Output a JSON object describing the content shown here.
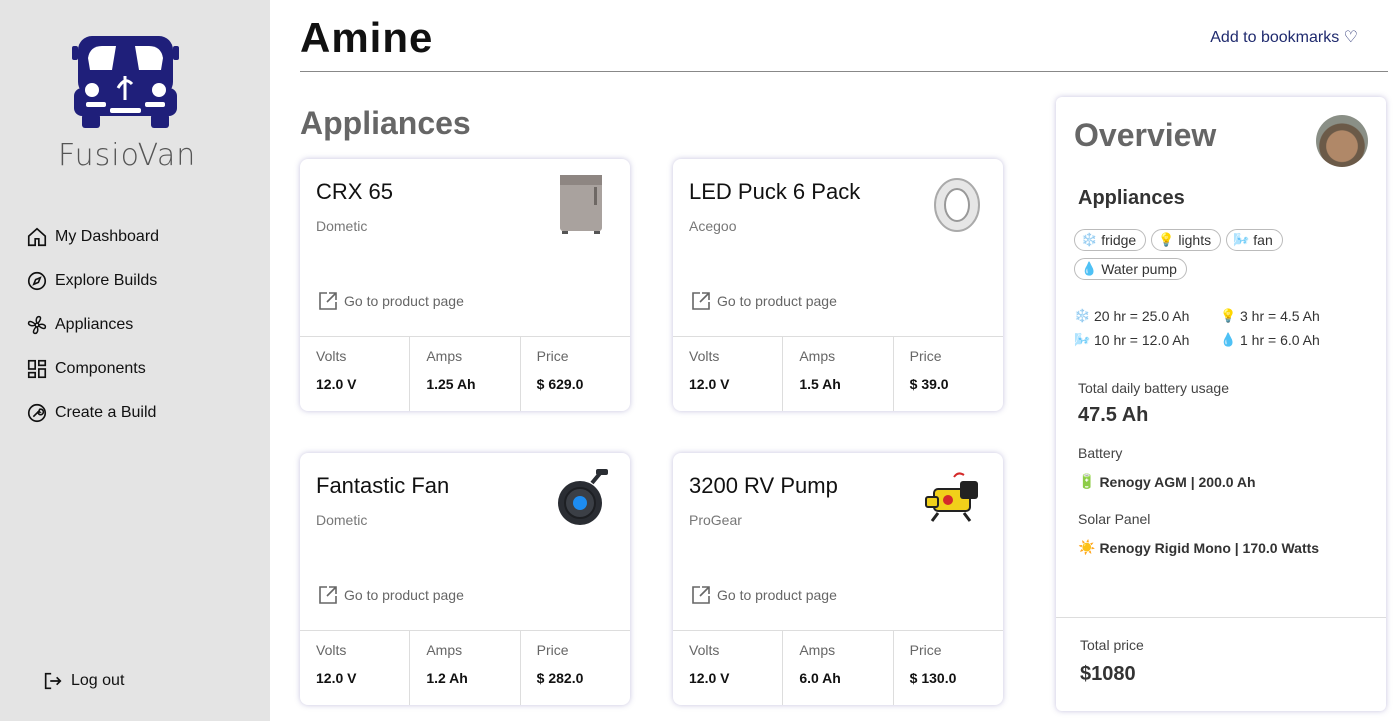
{
  "brand": {
    "name": "FusioVan"
  },
  "nav": [
    {
      "label": "My Dashboard",
      "icon": "home-icon"
    },
    {
      "label": "Explore Builds",
      "icon": "compass-icon"
    },
    {
      "label": "Appliances",
      "icon": "fan-icon"
    },
    {
      "label": "Components",
      "icon": "grid-icon"
    },
    {
      "label": "Create a Build",
      "icon": "wrench-icon"
    }
  ],
  "logout": {
    "label": "Log out"
  },
  "header": {
    "title": "Amine",
    "bookmark": "Add to bookmarks ♡"
  },
  "appliances_section": {
    "title": "Appliances"
  },
  "cards": [
    {
      "name": "CRX 65",
      "brand": "Dometic",
      "link": "Go to product page",
      "volts_label": "Volts",
      "volts": "12.0 V",
      "amps_label": "Amps",
      "amps": "1.25 Ah",
      "price_label": "Price",
      "price": "$ 629.0",
      "image": "fridge-image"
    },
    {
      "name": "LED Puck 6 Pack",
      "brand": "Acegoo",
      "link": "Go to product page",
      "volts_label": "Volts",
      "volts": "12.0 V",
      "amps_label": "Amps",
      "amps": "1.5 Ah",
      "price_label": "Price",
      "price": "$ 39.0",
      "image": "led-puck-image"
    },
    {
      "name": "Fantastic Fan",
      "brand": "Dometic",
      "link": "Go to product page",
      "volts_label": "Volts",
      "volts": "12.0 V",
      "amps_label": "Amps",
      "amps": "1.2 Ah",
      "price_label": "Price",
      "price": "$ 282.0",
      "image": "fan-image"
    },
    {
      "name": "3200 RV Pump",
      "brand": "ProGear",
      "link": "Go to product page",
      "volts_label": "Volts",
      "volts": "12.0 V",
      "amps_label": "Amps",
      "amps": "6.0 Ah",
      "price_label": "Price",
      "price": "$ 130.0",
      "image": "pump-image"
    }
  ],
  "overview": {
    "title": "Overview",
    "subtitle": "Appliances",
    "chips": [
      {
        "emoji": "❄️",
        "label": "fridge"
      },
      {
        "emoji": "💡",
        "label": "lights"
      },
      {
        "emoji": "🌬️",
        "label": "fan"
      },
      {
        "emoji": "💧",
        "label": "Water pump"
      }
    ],
    "usage": [
      {
        "emoji": "❄️",
        "text": "20 hr = 25.0 Ah"
      },
      {
        "emoji": "💡",
        "text": "3 hr = 4.5 Ah"
      },
      {
        "emoji": "🌬️",
        "text": "10 hr = 12.0 Ah"
      },
      {
        "emoji": "💧",
        "text": "1 hr = 6.0 Ah"
      }
    ],
    "daily_label": "Total daily battery usage",
    "daily_value": "47.5 Ah",
    "battery_label": "Battery",
    "battery_emoji": "🔋",
    "battery_value": "Renogy AGM | 200.0 Ah",
    "solar_label": "Solar Panel",
    "solar_emoji": "☀️",
    "solar_value": "Renogy Rigid Mono | 170.0 Watts",
    "total_label": "Total price",
    "total_value": "$1080"
  },
  "colors": {
    "sidebar_bg": "#e4e4e4",
    "brand_navy": "#1f1f7a",
    "link": "#1f2a6e"
  }
}
